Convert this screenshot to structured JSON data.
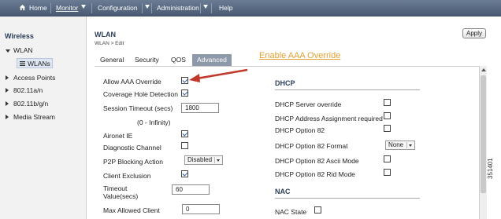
{
  "topnav": {
    "home": "Home",
    "monitor": "Monitor",
    "configuration": "Configuration",
    "administration": "Administration",
    "help": "Help"
  },
  "sidebar": {
    "title": "Wireless",
    "items": [
      {
        "label": "WLAN"
      },
      {
        "label": "WLANs"
      },
      {
        "label": "Access Points"
      },
      {
        "label": "802.11a/n"
      },
      {
        "label": "802.11b/g/n"
      },
      {
        "label": "Media Stream"
      }
    ]
  },
  "page": {
    "title": "WLAN",
    "breadcrumb": "WLAN > Edit",
    "apply_label": "Apply",
    "annotation": "Enable AAA Override"
  },
  "tabs": [
    {
      "label": "General"
    },
    {
      "label": "Security"
    },
    {
      "label": "QOS"
    },
    {
      "label": "Advanced",
      "active": true
    }
  ],
  "left_fields": {
    "allow_aaa_override": {
      "label": "Allow AAA Override",
      "checked": true
    },
    "coverage_hole": {
      "label": "Coverage Hole Detection",
      "checked": true
    },
    "session_timeout": {
      "label": "Session Timeout (secs)",
      "value": "1800"
    },
    "session_range": "(0 - Infinity)",
    "aironet_ie": {
      "label": "Aironet IE",
      "checked": true
    },
    "diagnostic_channel": {
      "label": "Diagnostic Channel",
      "checked": false
    },
    "p2p_blocking": {
      "label": "P2P Blocking Action",
      "value": "Disabled"
    },
    "client_exclusion": {
      "label": "Client Exclusion",
      "checked": true
    },
    "timeout": {
      "label_line1": "Timeout",
      "label_line2": "Value(secs)",
      "value": "60"
    },
    "max_allowed_client": {
      "label": "Max Allowed Client",
      "value": "0"
    }
  },
  "dhcp": {
    "title": "DHCP",
    "server_override": {
      "label": "DHCP Server override",
      "checked": false
    },
    "addr_required": {
      "label": "DHCP Address Assignment required",
      "checked": false
    },
    "option82": {
      "label": "DHCP Option 82",
      "checked": false
    },
    "option82_format": {
      "label": "DHCP Option 82 Format",
      "value": "None"
    },
    "option82_ascii": {
      "label": "DHCP Option 82 Ascii Mode",
      "checked": false
    },
    "option82_rid": {
      "label": "DHCP Option 82 Rid Mode",
      "checked": false
    }
  },
  "nac": {
    "title": "NAC",
    "state": {
      "label": "NAC State",
      "checked": false
    }
  },
  "figure_id": "351401",
  "colors": {
    "annotation": "#e3a12f",
    "arrow": "#c0392b",
    "topbar": "#5a6b84"
  }
}
